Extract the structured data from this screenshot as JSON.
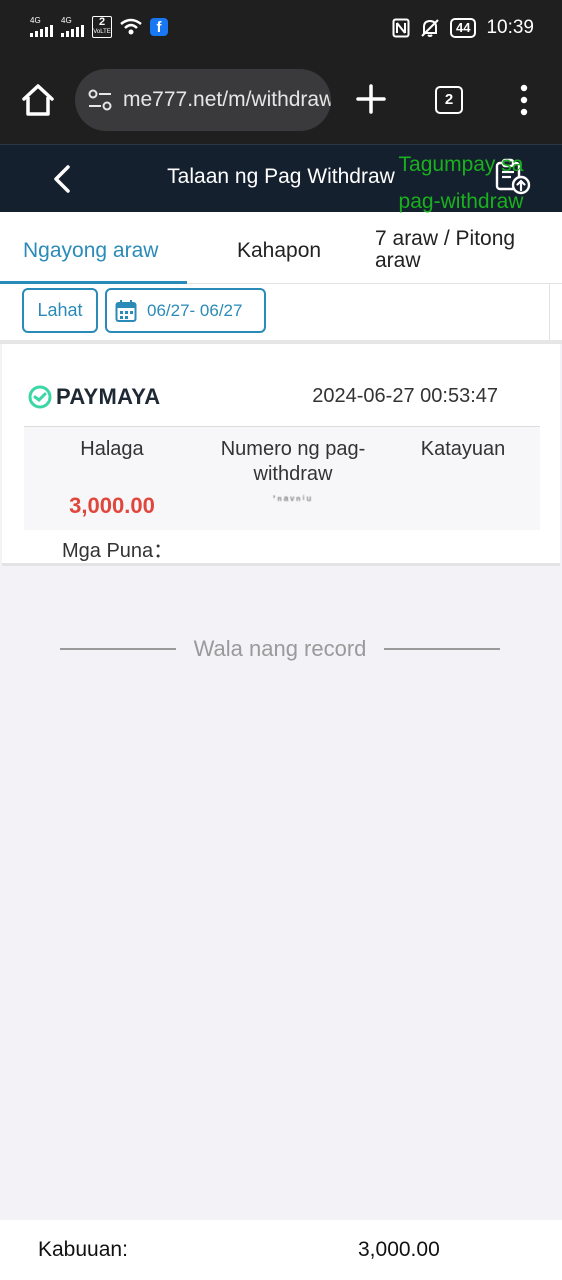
{
  "status_bar": {
    "sim1_tech": "4G",
    "sim2_tech": "4G",
    "sim2_number": "2",
    "volte_label": "VoLTE",
    "battery": "44",
    "time": "10:39",
    "icons": [
      "signal-icon",
      "wifi-icon",
      "facebook-icon",
      "nfc-icon",
      "muted-bell-icon",
      "battery-icon"
    ]
  },
  "browser": {
    "url": "me777.net/m/withdraw",
    "tab_count": "2",
    "icons": [
      "home-icon",
      "site-settings-icon",
      "new-tab-plus-icon",
      "tabs-icon",
      "more-vert-icon"
    ]
  },
  "app_header": {
    "title": "Talaan ng Pag Withdraw",
    "icons": [
      "back-chevron-icon",
      "clipboard-export-icon"
    ]
  },
  "tabs": [
    {
      "label": "Ngayong araw",
      "active": true
    },
    {
      "label": "Kahapon",
      "active": false
    },
    {
      "label": "7 araw / Pitong araw",
      "active": false
    }
  ],
  "filters": {
    "all_label": "Lahat",
    "date_range": "06/27- 06/27",
    "accent_color": "#2a8bb8"
  },
  "records": [
    {
      "channel": "PAYMAYA",
      "datetime": "2024-06-27 00:53:47",
      "amount_header": "Halaga",
      "number_header": "Numero ng pag-withdraw",
      "status_header": "Katayuan",
      "amount": "3,000.00",
      "withdraw_number": "’ⁿᵃᵛⁿⁱᵘ",
      "status": "Tagumpay sa pag-withdraw",
      "remarks_label": "Mga Puna："
    }
  ],
  "no_more_label": "Wala nang record",
  "footer": {
    "total_label": "Kabuuan:",
    "total_value": "3,000.00"
  },
  "colors": {
    "amount": "#e0463c",
    "status_success": "#18b01e",
    "header_bg": "#15202e"
  }
}
